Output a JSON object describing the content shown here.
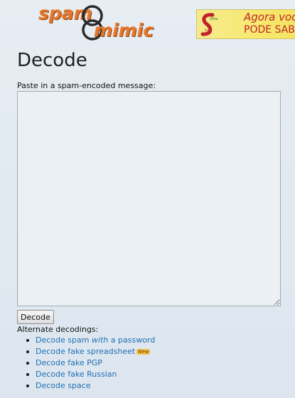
{
  "logo": {
    "word1": "spam",
    "word2": "mimic",
    "icon": "linked-rings-icon"
  },
  "ad": {
    "line1": "Agora você",
    "line2": "PODE SABER",
    "seal_text": "Ohio Safe"
  },
  "page": {
    "title": "Decode"
  },
  "form": {
    "label": "Paste in a spam-encoded message:",
    "textarea_value": "",
    "button_label": "Decode"
  },
  "alternate": {
    "title": "Alternate decodings:",
    "items": [
      {
        "before": "Decode spam ",
        "em": "with",
        "after": " a password"
      },
      {
        "label": "Decode fake spreadsheet",
        "badge": "New"
      },
      {
        "label": "Decode fake PGP"
      },
      {
        "label": "Decode fake Russian"
      },
      {
        "label": "Decode space"
      }
    ]
  },
  "colors": {
    "link": "#1c6fb5",
    "logo": "#e7772a",
    "ad_text": "#c0242b"
  }
}
